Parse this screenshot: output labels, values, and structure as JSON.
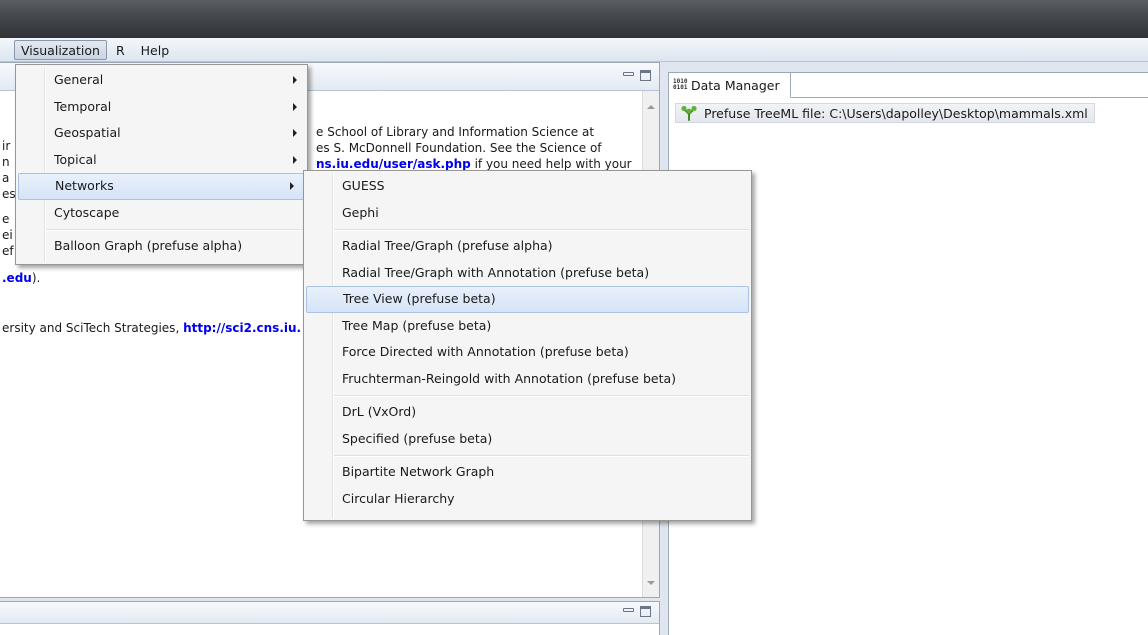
{
  "menubar": {
    "items": [
      {
        "label": "Visualization",
        "active": true
      },
      {
        "label": "R",
        "active": false
      },
      {
        "label": "Help",
        "active": false
      }
    ]
  },
  "visualization_menu": {
    "items": [
      {
        "label": "General"
      },
      {
        "label": "Temporal"
      },
      {
        "label": "Geospatial"
      },
      {
        "label": "Topical"
      },
      {
        "label": "Networks"
      },
      {
        "label": "Cytoscape"
      },
      {
        "label": "Balloon Graph (prefuse alpha)"
      }
    ]
  },
  "networks_submenu": {
    "items": [
      {
        "label": "GUESS"
      },
      {
        "label": "Gephi"
      },
      {
        "label": "Radial Tree/Graph (prefuse alpha)"
      },
      {
        "label": "Radial Tree/Graph with Annotation (prefuse beta)"
      },
      {
        "label": "Tree View (prefuse beta)"
      },
      {
        "label": "Tree Map (prefuse beta)"
      },
      {
        "label": "Force Directed with Annotation (prefuse beta)"
      },
      {
        "label": "Fruchterman-Reingold with Annotation (prefuse beta)"
      },
      {
        "label": "DrL (VxOrd)"
      },
      {
        "label": "Specified (prefuse beta)"
      },
      {
        "label": "Bipartite Network Graph"
      },
      {
        "label": "Circular Hierarchy"
      }
    ]
  },
  "console": {
    "line1": "e School of Library and Information Science at",
    "line2": "es S. McDonnell Foundation. See the Science of",
    "line3_link": "ns.iu.edu/user/ask.php",
    "line3_rest": " if you need help with your",
    "frag_edu": ".edu",
    "frag_edu_rest": ").",
    "line_sci2_prefix": "ersity and SciTech Strategies, ",
    "line_sci2_link": "http://sci2.cns.iu.",
    "left_frags": [
      "ir",
      "n",
      "a",
      "es",
      "e",
      "ei",
      "ef"
    ]
  },
  "data_manager": {
    "tab_label": "Data Manager",
    "tab_icon": "binary-data-icon",
    "items": [
      {
        "label": "Prefuse TreeML file: C:\\Users\\dapolley\\Desktop\\mammals.xml",
        "icon": "tree-icon"
      }
    ]
  },
  "colors": {
    "link": "#0000ee",
    "highlight_border": "#a9c3e6",
    "tree_icon": "#4a9a2a"
  }
}
